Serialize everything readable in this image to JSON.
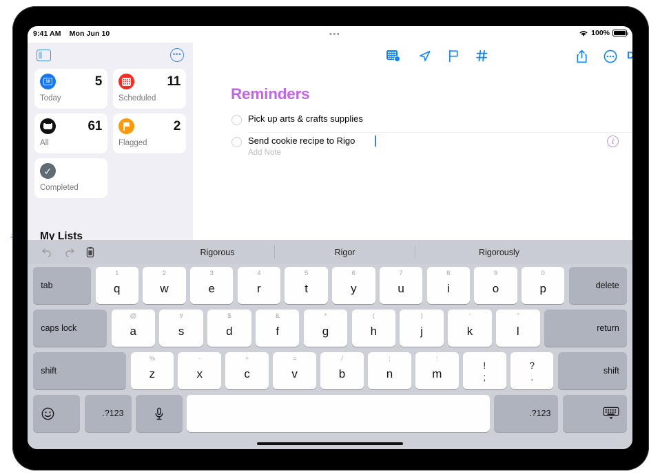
{
  "status_bar": {
    "time": "9:41 AM",
    "date": "Mon Jun 10",
    "dots": "•••",
    "battery_percent": "100%",
    "wifi_icon": "wifi-icon",
    "battery_icon": "battery-icon"
  },
  "sidebar": {
    "toggle_icon": "sidebar-toggle-icon",
    "more_icon": "more-circle-icon",
    "my_lists_header": "My Lists",
    "cards": [
      {
        "count": "5",
        "label": "Today",
        "icon": "calendar-day-icon",
        "color": "#1675ef",
        "day": "10"
      },
      {
        "count": "11",
        "label": "Scheduled",
        "icon": "calendar-icon",
        "color": "#fb2a1f"
      },
      {
        "count": "61",
        "label": "All",
        "icon": "inbox-tray-icon",
        "color": "#111114"
      },
      {
        "count": "2",
        "label": "Flagged",
        "icon": "flag-icon",
        "color": "#fb9a0a"
      },
      {
        "count": "",
        "label": "Completed",
        "icon": "checkmark-circle-icon",
        "color": "#606a74"
      }
    ]
  },
  "main": {
    "title": "Reminders",
    "title_color": "#c464e8",
    "toolbar": {
      "done_label": "Done",
      "icons": [
        "date-badge-icon",
        "location-arrow-icon",
        "flag-outline-icon",
        "hashtag-icon",
        "share-icon",
        "more-circle-icon"
      ]
    },
    "reminders": [
      {
        "text": "Pick up arts & crafts supplies",
        "note": "",
        "editing": false,
        "circle_icon": "unchecked-circle-icon"
      },
      {
        "text": "Send cookie recipe to Rigo",
        "note": "Add Note",
        "editing": true,
        "circle_icon": "unchecked-circle-icon",
        "info_icon": "info-circle-icon"
      }
    ]
  },
  "keyboard": {
    "toolbar_icons": [
      "undo-icon",
      "redo-icon",
      "paste-icon"
    ],
    "suggestions": [
      "Rigorous",
      "Rigor",
      "Rigorously"
    ],
    "rows": [
      {
        "keys": [
          {
            "label": "tab",
            "type": "mod",
            "width": 84
          },
          {
            "label": "q",
            "hint": "1",
            "type": "letter"
          },
          {
            "label": "w",
            "hint": "2",
            "type": "letter"
          },
          {
            "label": "e",
            "hint": "3",
            "type": "letter"
          },
          {
            "label": "r",
            "hint": "4",
            "type": "letter"
          },
          {
            "label": "t",
            "hint": "5",
            "type": "letter"
          },
          {
            "label": "y",
            "hint": "6",
            "type": "letter"
          },
          {
            "label": "u",
            "hint": "7",
            "type": "letter"
          },
          {
            "label": "i",
            "hint": "8",
            "type": "letter"
          },
          {
            "label": "o",
            "hint": "9",
            "type": "letter"
          },
          {
            "label": "p",
            "hint": "0",
            "type": "letter"
          },
          {
            "label": "delete",
            "type": "mod",
            "align": "right",
            "width": 84
          }
        ]
      },
      {
        "keys": [
          {
            "label": "caps lock",
            "type": "mod",
            "width": 107
          },
          {
            "label": "a",
            "hint": "@",
            "type": "letter"
          },
          {
            "label": "s",
            "hint": "#",
            "type": "letter"
          },
          {
            "label": "d",
            "hint": "$",
            "type": "letter"
          },
          {
            "label": "f",
            "hint": "&",
            "type": "letter"
          },
          {
            "label": "g",
            "hint": "*",
            "type": "letter"
          },
          {
            "label": "h",
            "hint": "(",
            "type": "letter"
          },
          {
            "label": "j",
            "hint": ")",
            "type": "letter"
          },
          {
            "label": "k",
            "hint": "‘",
            "type": "letter"
          },
          {
            "label": "l",
            "hint": "”",
            "type": "letter"
          },
          {
            "label": "return",
            "type": "mod",
            "align": "right",
            "width": 120
          }
        ]
      },
      {
        "keys": [
          {
            "label": "shift",
            "type": "mod",
            "width": 135
          },
          {
            "label": "z",
            "hint": "%",
            "type": "letter"
          },
          {
            "label": "x",
            "hint": "-",
            "type": "letter"
          },
          {
            "label": "c",
            "hint": "+",
            "type": "letter"
          },
          {
            "label": "v",
            "hint": "=",
            "type": "letter"
          },
          {
            "label": "b",
            "hint": "/",
            "type": "letter"
          },
          {
            "label": "n",
            "hint": ";",
            "type": "letter"
          },
          {
            "label": "m",
            "hint": ":",
            "type": "letter"
          },
          {
            "label": "!",
            "sub": ";",
            "type": "dual"
          },
          {
            "label": "?",
            "sub": ".",
            "type": "dual"
          },
          {
            "label": "shift",
            "type": "mod",
            "align": "right",
            "width": 100
          }
        ]
      },
      {
        "keys": [
          {
            "label": "☺",
            "type": "mod",
            "icon": "emoji-icon",
            "width": 68
          },
          {
            "label": ".?123",
            "type": "mod",
            "align": "center",
            "width": 68
          },
          {
            "label": "\u0001",
            "type": "mod",
            "icon": "microphone-icon",
            "width": 68
          },
          {
            "label": "",
            "type": "space",
            "icon": "spacebar"
          },
          {
            "label": ".?123",
            "type": "mod",
            "align": "right",
            "width": 93
          },
          {
            "label": "",
            "type": "mod",
            "icon": "hide-keyboard-icon",
            "width": 93
          }
        ]
      }
    ]
  }
}
